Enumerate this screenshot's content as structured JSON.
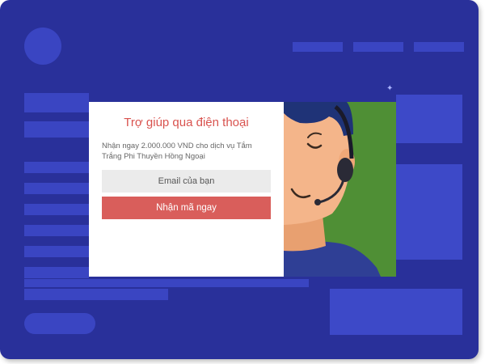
{
  "popup": {
    "title": "Trợ giúp qua điện thoại",
    "description": "Nhận ngay 2.000.000 VND cho dịch vụ Tắm Trắng Phi Thuyền Hồng Ngoại",
    "email_placeholder": "Email của bạn",
    "submit_label": "Nhận mã ngay",
    "illustration": "support-agent-headset"
  },
  "colors": {
    "background": "#29309a",
    "placeholder_blocks": "#3a45c2",
    "title_accent": "#d9534f",
    "button": "#d95e5b",
    "illustration_bg": "#5b9e3e"
  }
}
